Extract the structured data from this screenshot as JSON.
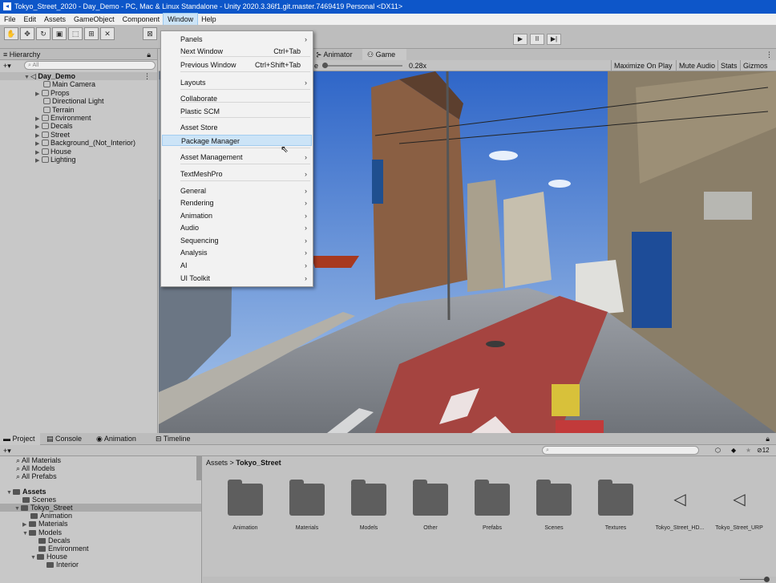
{
  "window_title": "Tokyo_Street_2020 - Day_Demo - PC, Mac & Linux Standalone - Unity 2020.3.36f1.git.master.7469419 Personal <DX11>",
  "menubar": [
    "File",
    "Edit",
    "Assets",
    "GameObject",
    "Component",
    "Window",
    "Help"
  ],
  "toolbar": {
    "play": "▶",
    "pause": "II",
    "step": "▶|"
  },
  "hierarchy": {
    "title": "Hierarchy",
    "search_placeholder": "All",
    "scene": "Day_Demo",
    "items": [
      "Main Camera",
      "Props",
      "Directional Light",
      "Terrain",
      "Environment",
      "Decals",
      "Street",
      "Background_(Not_Interior)",
      "House",
      "Lighting"
    ]
  },
  "scene_tabs": {
    "animator": "Animator",
    "game": "Game"
  },
  "game_controls": {
    "scale_label": "e",
    "scale_value": "0.28x",
    "maximize": "Maximize On Play",
    "mute": "Mute Audio",
    "stats": "Stats",
    "gizmos": "Gizmos"
  },
  "window_menu": {
    "items": [
      {
        "label": "Panels",
        "shortcut": "",
        "sub": true
      },
      {
        "label": "Next Window",
        "shortcut": "Ctrl+Tab",
        "sub": false
      },
      {
        "label": "Previous Window",
        "shortcut": "Ctrl+Shift+Tab",
        "sub": false
      },
      {
        "label": "Layouts",
        "shortcut": "",
        "sub": true
      },
      {
        "label": "Collaborate",
        "shortcut": "",
        "sub": false
      },
      {
        "label": "Plastic SCM",
        "shortcut": "",
        "sub": false
      },
      {
        "label": "Asset Store",
        "shortcut": "",
        "sub": false
      },
      {
        "label": "Package Manager",
        "shortcut": "",
        "sub": false
      },
      {
        "label": "Asset Management",
        "shortcut": "",
        "sub": true
      },
      {
        "label": "TextMeshPro",
        "shortcut": "",
        "sub": true
      },
      {
        "label": "General",
        "shortcut": "",
        "sub": true
      },
      {
        "label": "Rendering",
        "shortcut": "",
        "sub": true
      },
      {
        "label": "Animation",
        "shortcut": "",
        "sub": true
      },
      {
        "label": "Audio",
        "shortcut": "",
        "sub": true
      },
      {
        "label": "Sequencing",
        "shortcut": "",
        "sub": true
      },
      {
        "label": "Analysis",
        "shortcut": "",
        "sub": true
      },
      {
        "label": "AI",
        "shortcut": "",
        "sub": true
      },
      {
        "label": "UI Toolkit",
        "shortcut": "",
        "sub": true
      }
    ]
  },
  "bottom_tabs": [
    "Project",
    "Console",
    "Animation",
    "Timeline"
  ],
  "project": {
    "favorites": [
      "All Materials",
      "All Models",
      "All Prefabs"
    ],
    "assets_root": "Assets",
    "tree": [
      "Scenes",
      "Tokyo_Street",
      "Animation",
      "Materials",
      "Models",
      "Decals",
      "Environment",
      "House",
      "Interior"
    ],
    "breadcrumb_root": "Assets",
    "breadcrumb_current": "Tokyo_Street",
    "folders": [
      "Animation",
      "Materials",
      "Models",
      "Other",
      "Prefabs",
      "Scenes",
      "Textures"
    ],
    "unity_assets": [
      "Tokyo_Street_HD...",
      "Tokyo_Street_URP"
    ],
    "badge_count": "12"
  }
}
